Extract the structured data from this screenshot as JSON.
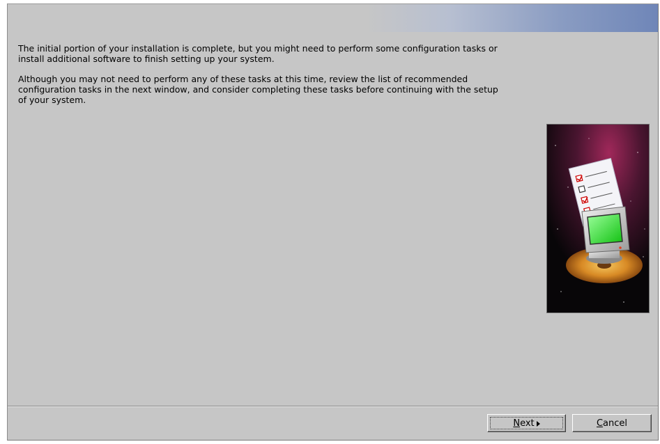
{
  "body": {
    "paragraph_1": "The initial portion of your installation is complete, but you might need to perform some configuration tasks or install additional software to finish setting up your system.",
    "paragraph_2": "Although you may not need to perform any of these tasks at this time, review the list of recommended configuration tasks in the next window, and consider completing these tasks before continuing with the setup of your system."
  },
  "illustration": {
    "icon": "checklist-computer-illustration"
  },
  "buttons": {
    "next": {
      "mnemonic": "N",
      "rest": "ext",
      "icon": "arrow-right-icon"
    },
    "cancel": {
      "mnemonic": "C",
      "rest": "ancel"
    }
  },
  "colors": {
    "window_bg": "#c6c6c6",
    "banner_accent": "#6f86b8"
  }
}
